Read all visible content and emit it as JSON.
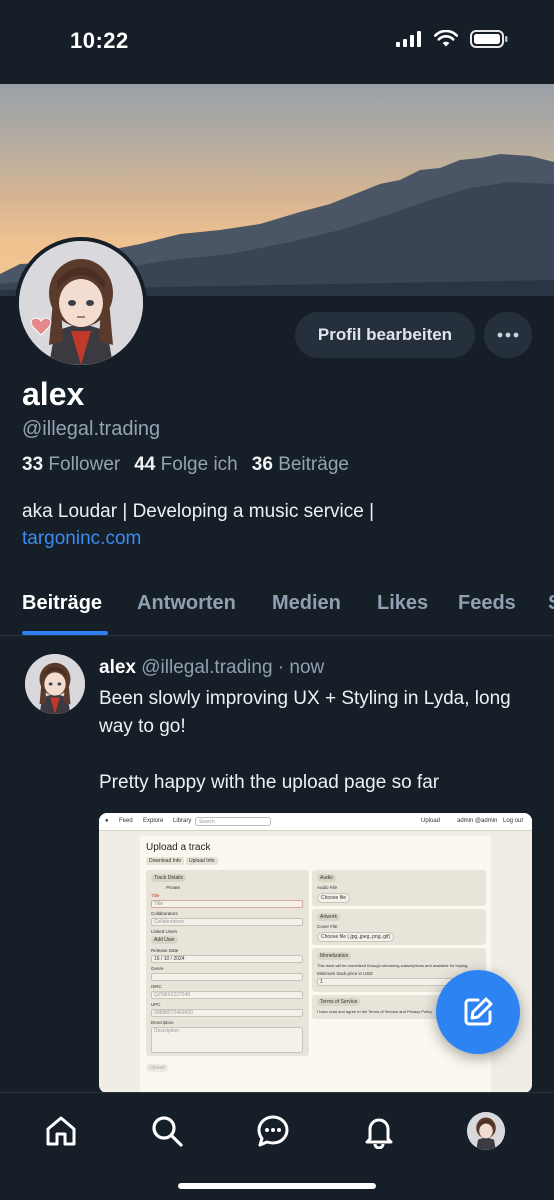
{
  "status_bar": {
    "time": "10:22"
  },
  "profile": {
    "display_name": "alex",
    "handle": "@illegal.trading",
    "edit_button_label": "Profil bearbeiten",
    "stats": {
      "followers_count": "33",
      "followers_label": "Follower",
      "following_count": "44",
      "following_label": "Folge ich",
      "posts_count": "36",
      "posts_label": "Beiträge"
    },
    "bio_text": "aka Loudar | Developing a music service |",
    "bio_link": "targoninc.com"
  },
  "tabs": [
    {
      "label": "Beiträge",
      "active": true
    },
    {
      "label": "Antworten",
      "active": false
    },
    {
      "label": "Medien",
      "active": false
    },
    {
      "label": "Likes",
      "active": false
    },
    {
      "label": "Feeds",
      "active": false
    },
    {
      "label": "S",
      "active": false
    }
  ],
  "post": {
    "author": "alex",
    "handle": "@illegal.trading",
    "time": "· now",
    "text_line1": "Been slowly improving UX + Styling in Lyda, long way to go!",
    "text_line2": "Pretty happy with the upload page so far",
    "image": {
      "nav_feed": "Feed",
      "nav_explore": "Explore",
      "nav_library": "Library",
      "search_placeholder": "Search",
      "upload": "Upload",
      "admin": "admin @admin",
      "logout": "Log out",
      "title": "Upload a track",
      "tab_download": "Download Info",
      "tab_upload": "Upload Info",
      "track_details": "Track Details",
      "private": "Private",
      "title_label": "Title",
      "title_placeholder": "Title",
      "collaborators_label": "Collaborators",
      "collaborators_placeholder": "Collaborators",
      "linked_users": "Linked Users",
      "add_user": "Add User",
      "release_date": "Release Date",
      "release_value": "16 / 10 / 2024",
      "genre": "Genre",
      "isrc": "ISRC",
      "isrc_value": "QZN8X2227540",
      "upc": "UPC",
      "upc_value": "00888072469600",
      "description": "Description",
      "description_placeholder": "Description",
      "audio": "Audio",
      "audio_file": "Audio File",
      "choose_file": "Choose file",
      "artwork": "Artwork",
      "cover_file": "Cover File",
      "choose_cover": "Choose file (.jpg,.jpeg,.png,.gif)",
      "monetization": "Monetization",
      "monetization_text": "This track will be monetized through streaming subscriptions and available for buying.",
      "min_price": "Minimum track price in USD",
      "min_price_value": "1",
      "terms": "Terms of Service",
      "terms_text": "I have read and agree to the Terms of Service and Privacy Policy",
      "submit": "Upload"
    }
  },
  "icons": {
    "fab": "compose-icon",
    "nav": [
      "home-icon",
      "search-icon",
      "chat-icon",
      "bell-icon",
      "profile-avatar"
    ]
  },
  "colors": {
    "accent": "#2e7ff2",
    "background": "#161e27",
    "surface": "#26303d"
  }
}
